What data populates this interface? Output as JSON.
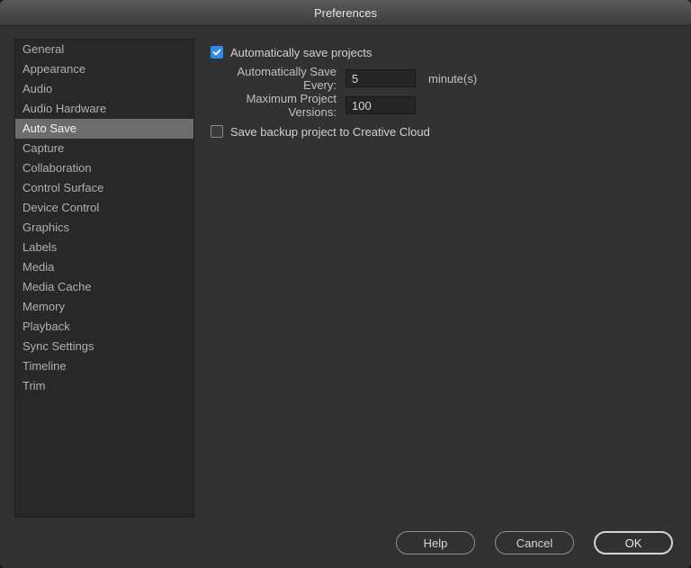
{
  "title": "Preferences",
  "sidebar": {
    "selected_index": 4,
    "items": [
      {
        "label": "General"
      },
      {
        "label": "Appearance"
      },
      {
        "label": "Audio"
      },
      {
        "label": "Audio Hardware"
      },
      {
        "label": "Auto Save"
      },
      {
        "label": "Capture"
      },
      {
        "label": "Collaboration"
      },
      {
        "label": "Control Surface"
      },
      {
        "label": "Device Control"
      },
      {
        "label": "Graphics"
      },
      {
        "label": "Labels"
      },
      {
        "label": "Media"
      },
      {
        "label": "Media Cache"
      },
      {
        "label": "Memory"
      },
      {
        "label": "Playback"
      },
      {
        "label": "Sync Settings"
      },
      {
        "label": "Timeline"
      },
      {
        "label": "Trim"
      }
    ]
  },
  "content": {
    "auto_save_checkbox_label": "Automatically save projects",
    "auto_save_checked": true,
    "save_every_label": "Automatically Save Every:",
    "save_every_value": "5",
    "save_every_unit": "minute(s)",
    "max_versions_label": "Maximum Project Versions:",
    "max_versions_value": "100",
    "backup_cloud_label": "Save backup project to Creative Cloud",
    "backup_cloud_checked": false
  },
  "footer": {
    "help": "Help",
    "cancel": "Cancel",
    "ok": "OK"
  }
}
